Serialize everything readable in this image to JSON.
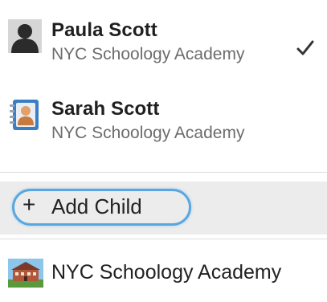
{
  "accounts": [
    {
      "name": "Paula Scott",
      "school": "NYC Schoology Academy",
      "selected": true,
      "icon": "person-silhouette-icon"
    },
    {
      "name": "Sarah Scott",
      "school": "NYC Schoology Academy",
      "selected": false,
      "icon": "contact-card-icon"
    }
  ],
  "selected_icon": "checkmark-icon",
  "add_child": {
    "plus": "+",
    "label": "Add Child",
    "highlight_color": "#59a7e2"
  },
  "school_link": {
    "label": "NYC Schoology Academy",
    "icon": "school-building-icon"
  }
}
